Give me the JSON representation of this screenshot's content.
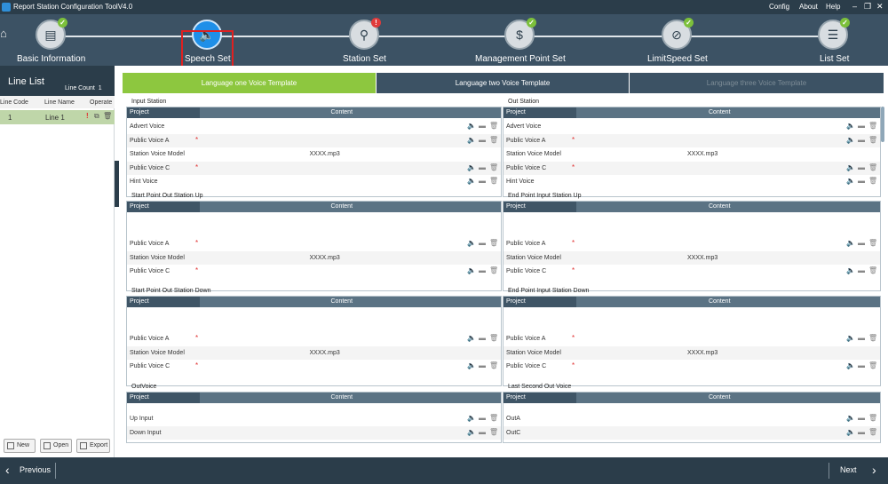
{
  "window": {
    "title": "Report Station Configuration ToolV4.0",
    "menu": [
      "Config",
      "About",
      "Help"
    ]
  },
  "steps": [
    {
      "label": "Basic Information",
      "icon": "document-icon",
      "status": "ok"
    },
    {
      "label": "Speech Set",
      "icon": "speaker-icon",
      "status": "active"
    },
    {
      "label": "Station Set",
      "icon": "location-pin-icon",
      "status": "error"
    },
    {
      "label": "Management Point Set",
      "icon": "dollar-icon",
      "status": "ok"
    },
    {
      "label": "LimitSpeed Set",
      "icon": "no-entry-icon",
      "status": "ok"
    },
    {
      "label": "List Set",
      "icon": "list-icon",
      "status": "ok"
    }
  ],
  "left": {
    "title": "Line List",
    "count_label": "Line Count",
    "count": "1",
    "columns": [
      "Line Code",
      "Line Name",
      "Operate"
    ],
    "rows": [
      {
        "code": "1",
        "name": "Line 1"
      }
    ],
    "buttons": [
      "New",
      "Open",
      "Export"
    ]
  },
  "tabs": [
    "Language one Voice Template",
    "Language two Voice Template",
    "Language three Voice Template"
  ],
  "panel_headers": {
    "project": "Project",
    "content": "Content"
  },
  "sections": {
    "input_station": {
      "title": "Input Station",
      "rows": [
        "Advert Voice",
        "Public Voice A",
        "Station Voice Model",
        "Public Voice C",
        "Hint Voice"
      ]
    },
    "out_station": {
      "title": "Out Station",
      "rows": [
        "Advert Voice",
        "Public Voice A",
        "Station Voice Model",
        "Public Voice C",
        "Hint Voice"
      ]
    },
    "start_up": {
      "title": "Start Point Out Station Up",
      "rows": [
        "Public Voice A",
        "Station Voice Model",
        "Public Voice C"
      ]
    },
    "end_up": {
      "title": "End Point Input Station Up",
      "rows": [
        "Public Voice A",
        "Station Voice Model",
        "Public Voice C"
      ]
    },
    "start_down": {
      "title": "Start Point Out Station Down",
      "rows": [
        "Public Voice A",
        "Station Voice Model",
        "Public Voice C"
      ]
    },
    "end_down": {
      "title": "End Point Input Station Down",
      "rows": [
        "Public Voice A",
        "Station Voice Model",
        "Public Voice C"
      ]
    },
    "outvoice": {
      "title": "OutVoice",
      "rows": [
        "Up Input",
        "Down Input"
      ]
    },
    "last_second": {
      "title": "Last Second Out Voice",
      "rows": [
        "OutA",
        "OutC"
      ]
    }
  },
  "model_value": "XXXX.mp3",
  "bottom": {
    "previous": "Previous",
    "next": "Next"
  },
  "colors": {
    "active_tab": "#8dc73f",
    "header": "#2b3d4a",
    "step_active": "#1e8fe8",
    "ok": "#7cc03b",
    "error": "#e03b3b"
  }
}
